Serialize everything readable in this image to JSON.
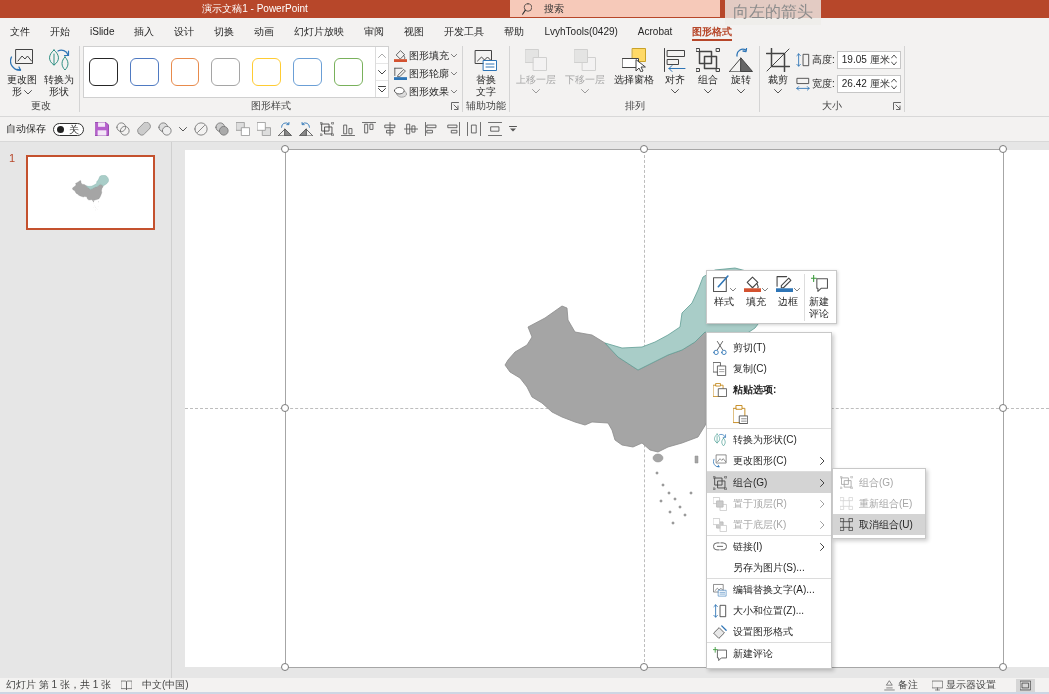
{
  "window": {
    "title": "演示文稿1 - PowerPoint"
  },
  "search": {
    "placeholder": "搜索"
  },
  "overlay_label": "向左的箭头",
  "tabs": [
    {
      "label": "文件",
      "selected": false
    },
    {
      "label": "开始",
      "selected": false
    },
    {
      "label": "iSlide",
      "selected": false
    },
    {
      "label": "插入",
      "selected": false
    },
    {
      "label": "设计",
      "selected": false
    },
    {
      "label": "切换",
      "selected": false
    },
    {
      "label": "动画",
      "selected": false
    },
    {
      "label": "幻灯片放映",
      "selected": false
    },
    {
      "label": "审阅",
      "selected": false
    },
    {
      "label": "视图",
      "selected": false
    },
    {
      "label": "开发工具",
      "selected": false
    },
    {
      "label": "帮助",
      "selected": false
    },
    {
      "label": "LvyhTools(0429)",
      "selected": false
    },
    {
      "label": "Acrobat",
      "selected": false
    },
    {
      "label": "图形格式",
      "selected": true
    }
  ],
  "ribbon": {
    "change": {
      "label": "更改",
      "buttons": [
        {
          "label": "更改图形",
          "has_menu": true
        },
        {
          "label": "转换为形状",
          "has_menu": false
        }
      ]
    },
    "shape_styles": {
      "label": "图形样式",
      "swatches": [
        {
          "color": "#262626",
          "selected": false
        },
        {
          "color": "#4f7ac2",
          "selected": false
        },
        {
          "color": "#e88b4c",
          "selected": false
        },
        {
          "color": "#a5a5a5",
          "selected": false
        },
        {
          "color": "#ffcc33",
          "selected": false
        },
        {
          "color": "#6b9fd6",
          "selected": false
        },
        {
          "color": "#79b15b",
          "selected": false
        }
      ],
      "commands": [
        {
          "label": "图形填充",
          "has_menu": true
        },
        {
          "label": "图形轮廓",
          "has_menu": true
        },
        {
          "label": "图形效果",
          "has_menu": true
        }
      ]
    },
    "accessibility": {
      "label": "辅助功能",
      "buttons": [
        {
          "label": "替换文字",
          "has_menu": false
        }
      ]
    },
    "arrange": {
      "label": "排列",
      "buttons": [
        {
          "label": "上移一层",
          "disabled": true,
          "has_menu": true
        },
        {
          "label": "下移一层",
          "disabled": true,
          "has_menu": true
        },
        {
          "label": "选择窗格",
          "disabled": false,
          "has_menu": false
        },
        {
          "label": "对齐",
          "disabled": false,
          "has_menu": true
        },
        {
          "label": "组合",
          "disabled": false,
          "has_menu": true
        },
        {
          "label": "旋转",
          "disabled": false,
          "has_menu": true
        }
      ]
    },
    "size": {
      "label": "大小",
      "buttons": [
        {
          "label": "裁剪",
          "has_menu": true
        }
      ],
      "fields": [
        {
          "label": "高度:",
          "value": "19.05 厘米"
        },
        {
          "label": "宽度:",
          "value": "26.42 厘米"
        }
      ]
    }
  },
  "quick_access": {
    "autosave": {
      "label": "自动保存",
      "toggle_text": "关",
      "on": false
    }
  },
  "slide_panel": {
    "slides": [
      {
        "number": "1",
        "selected": true
      }
    ]
  },
  "mini_toolbar": {
    "buttons": [
      {
        "label": "样式",
        "has_menu": true
      },
      {
        "label": "填充",
        "has_menu": true
      },
      {
        "label": "边框",
        "has_menu": true
      },
      {
        "label": "新建评论",
        "has_menu": false
      }
    ]
  },
  "context_menu": {
    "sections": [
      [
        {
          "kind": "command",
          "label": "剪切(T)",
          "disabled": false,
          "has_submenu": false,
          "selected": false
        },
        {
          "kind": "command",
          "label": "复制(C)",
          "disabled": false,
          "has_submenu": false,
          "selected": false
        },
        {
          "kind": "header",
          "label": "粘贴选项:"
        },
        {
          "kind": "paste_options"
        }
      ],
      [
        {
          "kind": "command",
          "label": "转换为形状(C)",
          "disabled": false,
          "has_submenu": false,
          "selected": false
        },
        {
          "kind": "command",
          "label": "更改图形(C)",
          "disabled": false,
          "has_submenu": true,
          "selected": false
        }
      ],
      [
        {
          "kind": "command",
          "label": "组合(G)",
          "disabled": false,
          "has_submenu": true,
          "selected": true
        },
        {
          "kind": "command",
          "label": "置于顶层(R)",
          "disabled": true,
          "has_submenu": true,
          "selected": false
        },
        {
          "kind": "command",
          "label": "置于底层(K)",
          "disabled": true,
          "has_submenu": true,
          "selected": false
        }
      ],
      [
        {
          "kind": "command",
          "label": "链接(I)",
          "disabled": false,
          "has_submenu": true,
          "selected": false
        },
        {
          "kind": "command",
          "label": "另存为图片(S)...",
          "disabled": false,
          "has_submenu": false,
          "selected": false
        }
      ],
      [
        {
          "kind": "command",
          "label": "编辑替换文字(A)...",
          "disabled": false,
          "has_submenu": false,
          "selected": false
        },
        {
          "kind": "command",
          "label": "大小和位置(Z)...",
          "disabled": false,
          "has_submenu": false,
          "selected": false
        },
        {
          "kind": "command",
          "label": "设置图形格式",
          "disabled": false,
          "has_submenu": false,
          "selected": false
        }
      ],
      [
        {
          "kind": "command",
          "label": "新建评论",
          "disabled": false,
          "has_submenu": false,
          "selected": false
        }
      ]
    ]
  },
  "submenu": {
    "items": [
      {
        "label": "组合(G)",
        "disabled": true,
        "selected": false
      },
      {
        "label": "重新组合(E)",
        "disabled": true,
        "selected": false
      },
      {
        "label": "取消组合(U)",
        "disabled": false,
        "selected": true
      }
    ]
  },
  "status_bar": {
    "slide_info": "幻灯片 第 1 张，共 1 张",
    "language": "中文(中国)",
    "notes": "备注",
    "display_settings": "显示器设置"
  }
}
